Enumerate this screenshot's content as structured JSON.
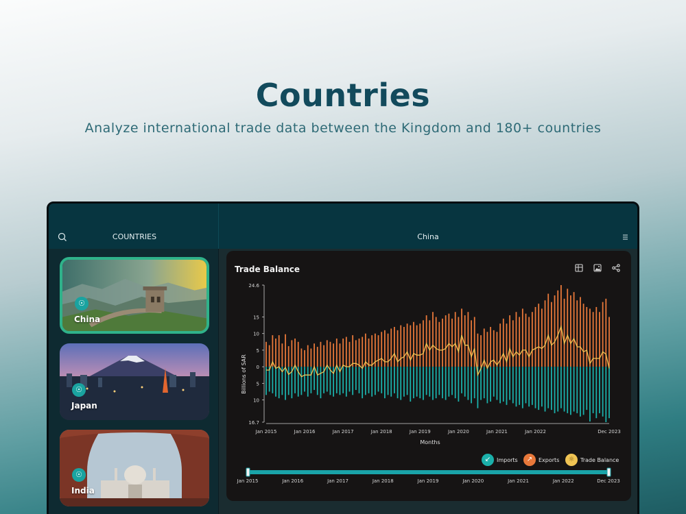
{
  "hero": {
    "title": "Countries",
    "subtitle": "Analyze international trade data between the Kingdom and 180+ countries"
  },
  "header": {
    "sidebar_title": "COUNTRIES",
    "country_title": "China",
    "icons": [
      "search-icon",
      "menu-icon"
    ]
  },
  "sidebar": {
    "cards": [
      {
        "name": "China",
        "selected": true
      },
      {
        "name": "Japan",
        "selected": false
      },
      {
        "name": "India",
        "selected": false
      }
    ]
  },
  "panel": {
    "title": "Trade Balance",
    "tools": [
      "table-icon",
      "image-icon",
      "share-icon"
    ]
  },
  "legend": {
    "imports": "Imports",
    "exports": "Exports",
    "trade_balance": "Trade Balance"
  },
  "colors": {
    "imports": "#1bb0aa",
    "exports": "#e8783a",
    "trade_balance": "#f0c454",
    "accent": "#2fb28a"
  },
  "chart_data": {
    "type": "bar",
    "ylabel": "Billions of SAR",
    "xlabel": "Months",
    "ylim": [
      -16.7,
      24.6
    ],
    "y_ticks": [
      {
        "label": "24.6",
        "value": 24.6
      },
      {
        "label": "15",
        "value": 15
      },
      {
        "label": "10",
        "value": 10
      },
      {
        "label": "5",
        "value": 5
      },
      {
        "label": "0",
        "value": 0
      },
      {
        "label": "5",
        "value": -5
      },
      {
        "label": "10",
        "value": -10
      },
      {
        "label": "16.7",
        "value": -16.7
      }
    ],
    "x_ticks": [
      {
        "label": "Jan 2015",
        "index": 0
      },
      {
        "label": "Jan 2016",
        "index": 12
      },
      {
        "label": "Jan 2017",
        "index": 24
      },
      {
        "label": "Jan 2018",
        "index": 36
      },
      {
        "label": "Jan 2019",
        "index": 48
      },
      {
        "label": "Jan 2020",
        "index": 60
      },
      {
        "label": "Jan 2021",
        "index": 72
      },
      {
        "label": "Jan 2022",
        "index": 84
      },
      {
        "label": "Dec 2023",
        "index": 107
      }
    ],
    "slider_labels": [
      "Jan 2015",
      "Jan 2016",
      "Jan 2017",
      "Jan 2018",
      "Jan 2019",
      "Jan 2020",
      "Jan 2021",
      "Jan 2022",
      "Dec 2023"
    ],
    "series": [
      {
        "name": "Exports",
        "values": [
          7.5,
          6.5,
          9.5,
          8.5,
          9.5,
          7.0,
          9.8,
          6.2,
          8.0,
          8.5,
          7.5,
          5.5,
          5.0,
          6.5,
          5.5,
          7.0,
          6.0,
          7.5,
          6.5,
          8.0,
          7.5,
          7.0,
          8.5,
          7.0,
          8.5,
          9.0,
          7.5,
          9.5,
          8.0,
          8.5,
          9.0,
          10.0,
          8.5,
          9.5,
          10.0,
          9.5,
          10.5,
          11.0,
          10.0,
          11.5,
          12.0,
          11.0,
          12.5,
          12.0,
          13.0,
          12.5,
          13.5,
          12.5,
          13.0,
          14.0,
          15.5,
          14.0,
          16.5,
          15.0,
          13.5,
          14.5,
          15.5,
          16.0,
          14.5,
          16.5,
          15.0,
          17.5,
          15.5,
          16.5,
          14.0,
          15.0,
          10.0,
          9.5,
          11.5,
          10.5,
          12.0,
          11.0,
          10.5,
          13.0,
          14.5,
          13.0,
          15.5,
          14.0,
          16.5,
          15.0,
          17.5,
          16.0,
          15.0,
          16.5,
          18.0,
          19.0,
          17.5,
          20.0,
          22.0,
          19.5,
          21.5,
          23.0,
          24.6,
          20.5,
          23.5,
          21.5,
          22.5,
          20.0,
          21.0,
          19.0,
          18.0,
          17.5,
          16.5,
          18.0,
          16.5,
          19.5,
          20.5,
          15.0
        ]
      },
      {
        "name": "Imports",
        "values": [
          -8.5,
          -7.5,
          -8.0,
          -9.0,
          -9.5,
          -8.5,
          -10.0,
          -8.5,
          -9.5,
          -8.0,
          -9.0,
          -8.5,
          -7.5,
          -9.0,
          -8.0,
          -7.0,
          -8.5,
          -9.5,
          -8.0,
          -7.5,
          -8.5,
          -9.0,
          -8.0,
          -8.5,
          -8.0,
          -9.0,
          -7.5,
          -8.5,
          -7.0,
          -8.0,
          -9.5,
          -8.5,
          -8.0,
          -9.0,
          -8.5,
          -7.5,
          -8.0,
          -9.5,
          -8.5,
          -9.0,
          -8.0,
          -9.5,
          -10.0,
          -9.0,
          -8.5,
          -10.5,
          -9.5,
          -9.0,
          -9.5,
          -10.0,
          -8.5,
          -9.0,
          -10.0,
          -9.5,
          -8.5,
          -9.5,
          -10.0,
          -9.0,
          -8.5,
          -9.5,
          -10.5,
          -8.0,
          -9.0,
          -10.0,
          -11.0,
          -9.5,
          -12.5,
          -10.0,
          -9.5,
          -11.0,
          -10.5,
          -9.0,
          -10.0,
          -11.0,
          -10.5,
          -11.5,
          -10.0,
          -11.0,
          -12.0,
          -11.5,
          -12.5,
          -11.0,
          -12.0,
          -11.5,
          -12.5,
          -13.0,
          -12.0,
          -13.5,
          -12.5,
          -13.0,
          -14.0,
          -13.5,
          -12.5,
          -13.5,
          -14.0,
          -14.5,
          -13.5,
          -14.0,
          -15.0,
          -14.5,
          -13.0,
          -16.5,
          -14.0,
          -15.5,
          -14.0,
          -15.0,
          -16.7,
          -15.5
        ]
      },
      {
        "name": "Trade Balance",
        "values": [
          -1.0,
          -1.0,
          1.5,
          -0.5,
          0.0,
          -1.5,
          -0.2,
          -2.3,
          -1.5,
          0.5,
          -1.5,
          -3.0,
          -2.5,
          -2.5,
          -2.5,
          0.0,
          -2.5,
          -2.0,
          -1.5,
          0.5,
          -1.0,
          -2.0,
          0.5,
          -1.5,
          0.5,
          0.0,
          0.0,
          1.0,
          1.0,
          0.5,
          -0.5,
          1.5,
          0.5,
          0.5,
          1.5,
          2.0,
          2.5,
          1.5,
          1.5,
          2.5,
          4.0,
          1.5,
          2.5,
          3.0,
          4.5,
          2.0,
          4.0,
          3.5,
          3.5,
          4.0,
          7.0,
          5.0,
          6.5,
          5.5,
          5.0,
          5.0,
          5.5,
          7.0,
          6.0,
          7.0,
          4.5,
          9.5,
          6.5,
          6.5,
          3.0,
          5.5,
          -2.5,
          -0.5,
          2.0,
          -0.5,
          1.5,
          2.0,
          0.5,
          2.0,
          4.0,
          1.5,
          5.5,
          3.0,
          4.5,
          3.5,
          5.0,
          5.0,
          3.0,
          5.0,
          5.5,
          6.0,
          5.5,
          6.5,
          9.5,
          6.5,
          7.5,
          9.5,
          12.1,
          7.0,
          9.5,
          7.0,
          8.5,
          6.0,
          6.0,
          4.5,
          5.0,
          1.0,
          2.5,
          2.5,
          2.5,
          4.5,
          3.8,
          -0.5
        ]
      }
    ]
  }
}
